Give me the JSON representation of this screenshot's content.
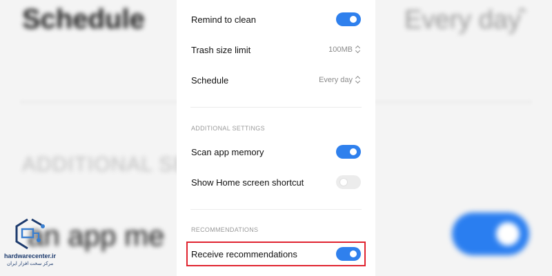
{
  "background": {
    "title": "Schedule",
    "schedule_value": "Every day",
    "section": "ADDITIONAL SETT",
    "row": "an app me"
  },
  "settings": {
    "remind": {
      "label": "Remind to clean",
      "enabled": true
    },
    "trash": {
      "label": "Trash size limit",
      "value": "100MB"
    },
    "schedule": {
      "label": "Schedule",
      "value": "Every day"
    },
    "additional_section": "ADDITIONAL SETTINGS",
    "scan": {
      "label": "Scan app memory",
      "enabled": true
    },
    "shortcut": {
      "label": "Show Home screen shortcut",
      "enabled": false
    },
    "recommendations_section": "RECOMMENDATIONS",
    "receive": {
      "label": "Receive recommendations",
      "enabled": true
    }
  },
  "colors": {
    "toggle_on": "#2f80ed",
    "toggle_off": "#ececec",
    "highlight": "#e0232f"
  },
  "watermark": {
    "name": "hardwarecenter.ir",
    "subtitle": "مرکز سخت افزار ایران"
  }
}
